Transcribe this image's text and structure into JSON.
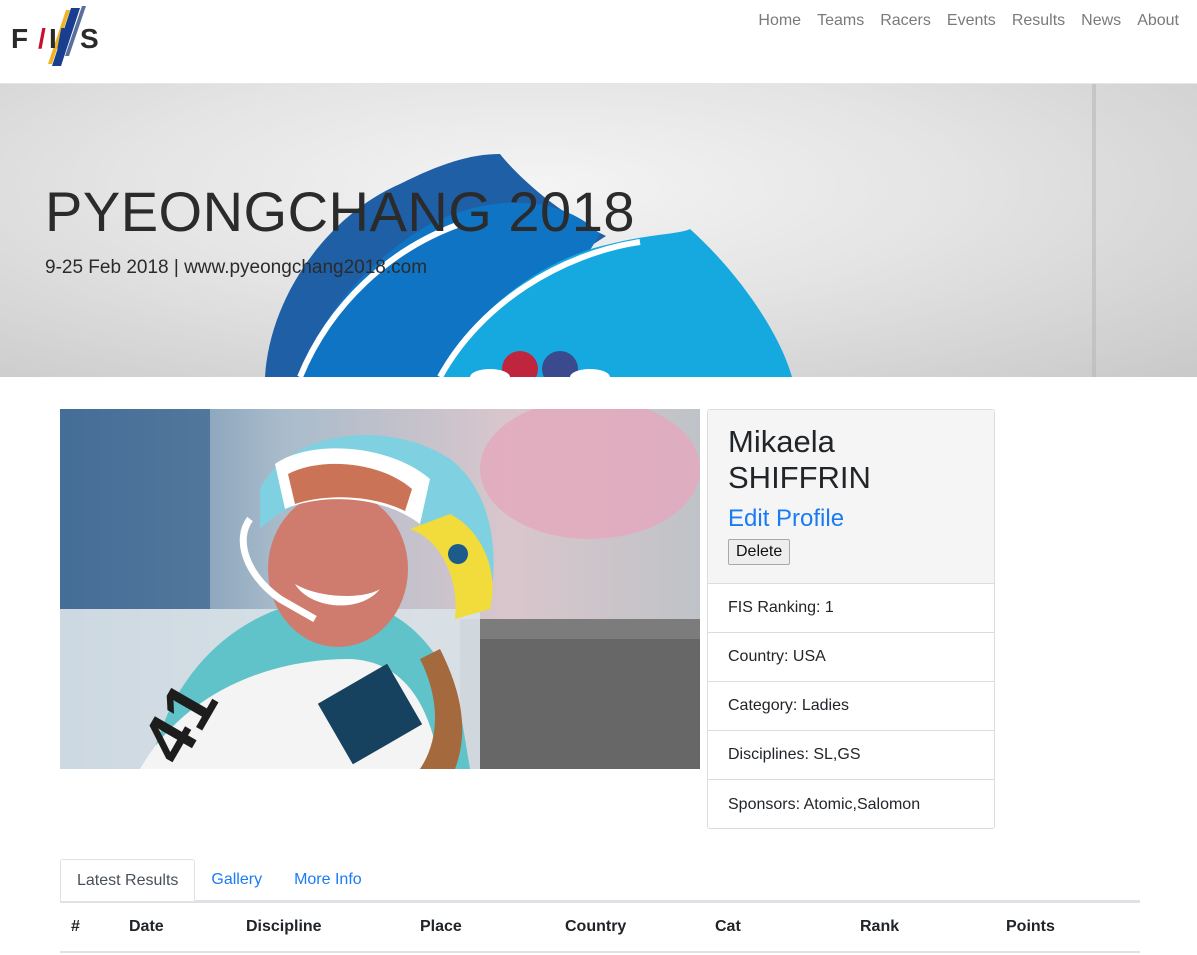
{
  "nav": {
    "logo_text": "FIS",
    "links": [
      "Home",
      "Teams",
      "Racers",
      "Events",
      "Results",
      "News",
      "About"
    ]
  },
  "hero": {
    "title": "PYEONGCHANG 2018",
    "subtitle": "9-25 Feb 2018 | www.pyeongchang2018.com"
  },
  "profile": {
    "first_name": "Mikaela",
    "last_name": "SHIFFRIN",
    "edit_label": "Edit Profile",
    "delete_label": "Delete",
    "details": [
      "FIS Ranking: 1",
      "Country: USA",
      "Category: Ladies",
      "Disciplines: SL,GS",
      "Sponsors: Atomic,Salomon"
    ]
  },
  "tabs": [
    "Latest Results",
    "Gallery",
    "More Info"
  ],
  "results_table": {
    "columns": [
      "#",
      "Date",
      "Discipline",
      "Place",
      "Country",
      "Cat",
      "Rank",
      "Points"
    ]
  },
  "colors": {
    "link": "#1a7cf4",
    "hero_blue_dark": "#1f5fa6",
    "hero_blue": "#0f74c4",
    "hero_blue_light": "#16a9e0",
    "logo_red": "#c8102e"
  }
}
